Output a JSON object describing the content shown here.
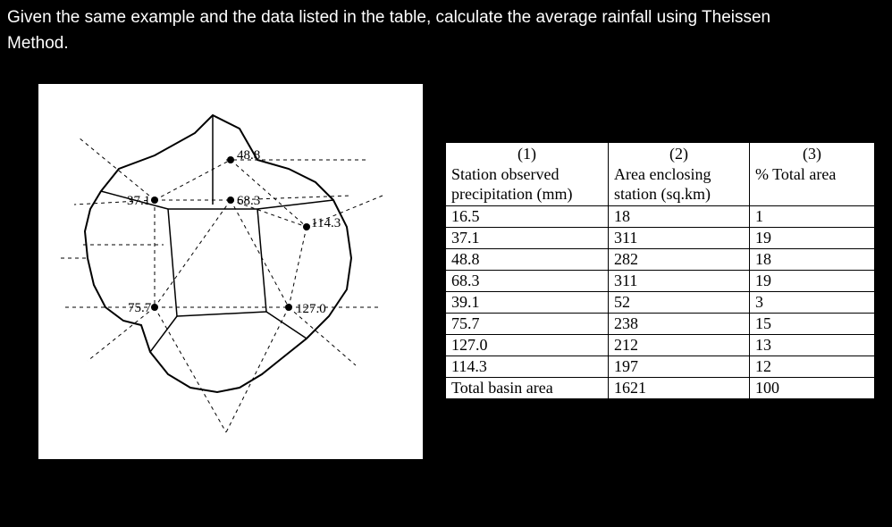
{
  "question": {
    "line1": "Given the same example and the data listed in the table, calculate the average rainfall using Theissen",
    "line2": "Method."
  },
  "diagram_labels": {
    "p1": "48.8",
    "p2": "37.1",
    "p3": "68.3",
    "p4": "114.3",
    "p5": "75.7",
    "p6": "127.0"
  },
  "table": {
    "headers": {
      "c1_num": "(1)",
      "c1_txt": "Station observed precipitation (mm)",
      "c2_num": "(2)",
      "c2_txt": "Area enclosing station (sq.km)",
      "c3_num": "(3)",
      "c3_txt": "% Total area"
    },
    "rows": [
      {
        "precip": "16.5",
        "area": "18",
        "pct": "1"
      },
      {
        "precip": "37.1",
        "area": "311",
        "pct": "19"
      },
      {
        "precip": "48.8",
        "area": "282",
        "pct": "18"
      },
      {
        "precip": "68.3",
        "area": "311",
        "pct": "19"
      },
      {
        "precip": "39.1",
        "area": "52",
        "pct": "3"
      },
      {
        "precip": "75.7",
        "area": "238",
        "pct": "15"
      },
      {
        "precip": "127.0",
        "area": "212",
        "pct": "13"
      },
      {
        "precip": "114.3",
        "area": "197",
        "pct": "12"
      }
    ],
    "total": {
      "label": "Total basin area",
      "area": "1621",
      "pct": "100"
    }
  },
  "chart_data": {
    "type": "table",
    "title": "Theissen method rainfall/area data",
    "columns": [
      "Station observed precipitation (mm)",
      "Area enclosing station (sq.km)",
      "% Total area"
    ],
    "rows": [
      [
        16.5,
        18,
        1
      ],
      [
        37.1,
        311,
        19
      ],
      [
        48.8,
        282,
        18
      ],
      [
        68.3,
        311,
        19
      ],
      [
        39.1,
        52,
        3
      ],
      [
        75.7,
        238,
        15
      ],
      [
        127.0,
        212,
        13
      ],
      [
        114.3,
        197,
        12
      ]
    ],
    "totals": {
      "label": "Total basin area",
      "area": 1621,
      "pct": 100
    }
  }
}
